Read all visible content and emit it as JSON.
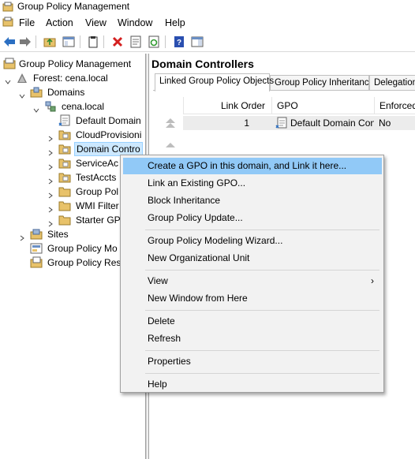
{
  "window": {
    "title": "Group Policy Management"
  },
  "menubar": {
    "items": [
      "File",
      "Action",
      "View",
      "Window",
      "Help"
    ]
  },
  "toolbar": {
    "buttons": [
      "back-icon",
      "forward-icon",
      "up-folder-icon",
      "show-tree-icon",
      "clipboard-icon",
      "delete-icon",
      "properties-icon",
      "refresh-icon",
      "help-icon",
      "show-pane-icon"
    ]
  },
  "tree": {
    "root": "Group Policy Management",
    "forest": "Forest: cena.local",
    "domains": "Domains",
    "domain": "cena.local",
    "children": [
      "Default Domain Policy",
      "CloudProvisioning",
      "Domain Controllers",
      "ServiceAccounts",
      "TestAccts",
      "Group Policy Objects",
      "WMI Filters",
      "Starter GPOs"
    ],
    "sites": "Sites",
    "modeling": "Group Policy Modeling",
    "results": "Group Policy Results"
  },
  "tree_visible": {
    "children": [
      "Default Domain",
      "CloudProvisioni",
      "Domain Contro",
      "ServiceAc",
      "TestAccts",
      "Group Pol",
      "WMI Filter",
      "Starter GP"
    ],
    "modeling": "Group Policy Mo",
    "results": "Group Policy Res"
  },
  "right_pane": {
    "title": "Domain Controllers",
    "tabs": [
      "Linked Group Policy Objects",
      "Group Policy Inheritance",
      "Delegation"
    ],
    "columns": [
      "Link Order",
      "GPO",
      "Enforced"
    ],
    "rows": [
      {
        "link_order": "1",
        "gpo": "Default Domain Con...",
        "enforced": "No"
      }
    ]
  },
  "context_menu": {
    "items": [
      "Create a GPO in this domain, and Link it here...",
      "Link an Existing GPO...",
      "Block Inheritance",
      "Group Policy Update...",
      "Group Policy Modeling Wizard...",
      "New Organizational Unit",
      "View",
      "New Window from Here",
      "Delete",
      "Refresh",
      "Properties",
      "Help"
    ],
    "highlighted": "Create a GPO in this domain, and Link it here...",
    "submenu_arrow": "›"
  },
  "colors": {
    "selection": "#cce8ff",
    "menu_highlight": "#91c9f7",
    "menu_bg": "#f2f2f2"
  }
}
